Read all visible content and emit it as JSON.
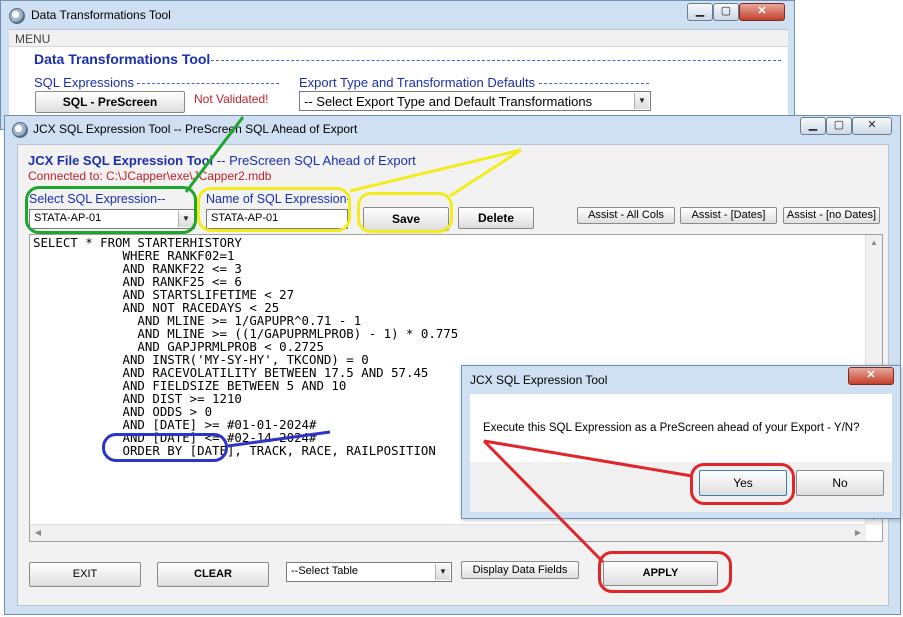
{
  "back_window": {
    "title": "Data Transformations Tool",
    "menu": "MENU",
    "heading": "Data Transformations Tool",
    "sql_section_label": "SQL Expressions",
    "prescreen_button": "SQL - PreScreen",
    "validation_status": "Not Validated!",
    "export_section_label": "Export Type and Transformation Defaults",
    "export_select_value": "-- Select Export Type and Default Transformations",
    "caption_buttons": {
      "minimize": "▁",
      "maximize": "▢",
      "close": "✕"
    }
  },
  "sql_window": {
    "title": "JCX SQL Expression Tool -- PreScreen SQL Ahead of Export",
    "heading_bold": "JCX File SQL Expression Tool",
    "heading_rest": " -- PreScreen SQL Ahead of Export",
    "connection": "Connected to: C:\\JCapper\\exe\\JCapper2.mdb",
    "select_label": "Select SQL Expression--",
    "select_value": "STATA-AP-01",
    "name_label": "Name of SQL Expression-",
    "name_value": "STATA-AP-01",
    "save_button": "Save",
    "delete_button": "Delete",
    "assist_all_cols": "Assist - All Cols",
    "assist_dates": "Assist - [Dates]",
    "assist_no_dates": "Assist - [no Dates]",
    "sql_lines": [
      "SELECT * FROM STARTERHISTORY",
      "            WHERE RANKF02=1",
      "            AND RANKF22 <= 3",
      "            AND RANKF25 <= 6",
      "            AND STARTSLIFETIME < 27",
      "            AND NOT RACEDAYS < 25",
      "",
      "              AND MLINE >= 1/GAPUPR^0.71 - 1",
      "              AND MLINE >= ((1/GAPUPRMLPROB) - 1) * 0.775",
      "              AND GAPJPRMLPROB < 0.2725",
      "",
      "            AND INSTR('MY-SY-HY', TKCOND) = 0",
      "            AND RACEVOLATILITY BETWEEN 17.5 AND 57.45",
      "            AND FIELDSIZE BETWEEN 5 AND 10",
      "            AND DIST >= 1210",
      "",
      "            AND ODDS > 0",
      "",
      "            AND [DATE] >= #01-01-2024#",
      "            AND [DATE] <= #02-14-2024#",
      "            ORDER BY [DATE], TRACK, RACE, RAILPOSITION"
    ],
    "exit_button": "EXIT",
    "clear_button": "CLEAR",
    "table_select_value": "--Select Table",
    "display_fields_button": "Display Data Fields",
    "apply_button": "APPLY",
    "caption_buttons": {
      "minimize": "▁",
      "maximize": "▢",
      "close": "✕"
    }
  },
  "dialog": {
    "title": "JCX SQL Expression Tool",
    "message": "Execute this SQL Expression as a PreScreen ahead of your Export - Y/N?",
    "yes_button": "Yes",
    "no_button": "No",
    "close": "✕"
  },
  "annotation_colors": {
    "green": "#1fa52c",
    "yellow": "#f2ec1c",
    "blue": "#2c35c8",
    "red": "#e0262a"
  }
}
